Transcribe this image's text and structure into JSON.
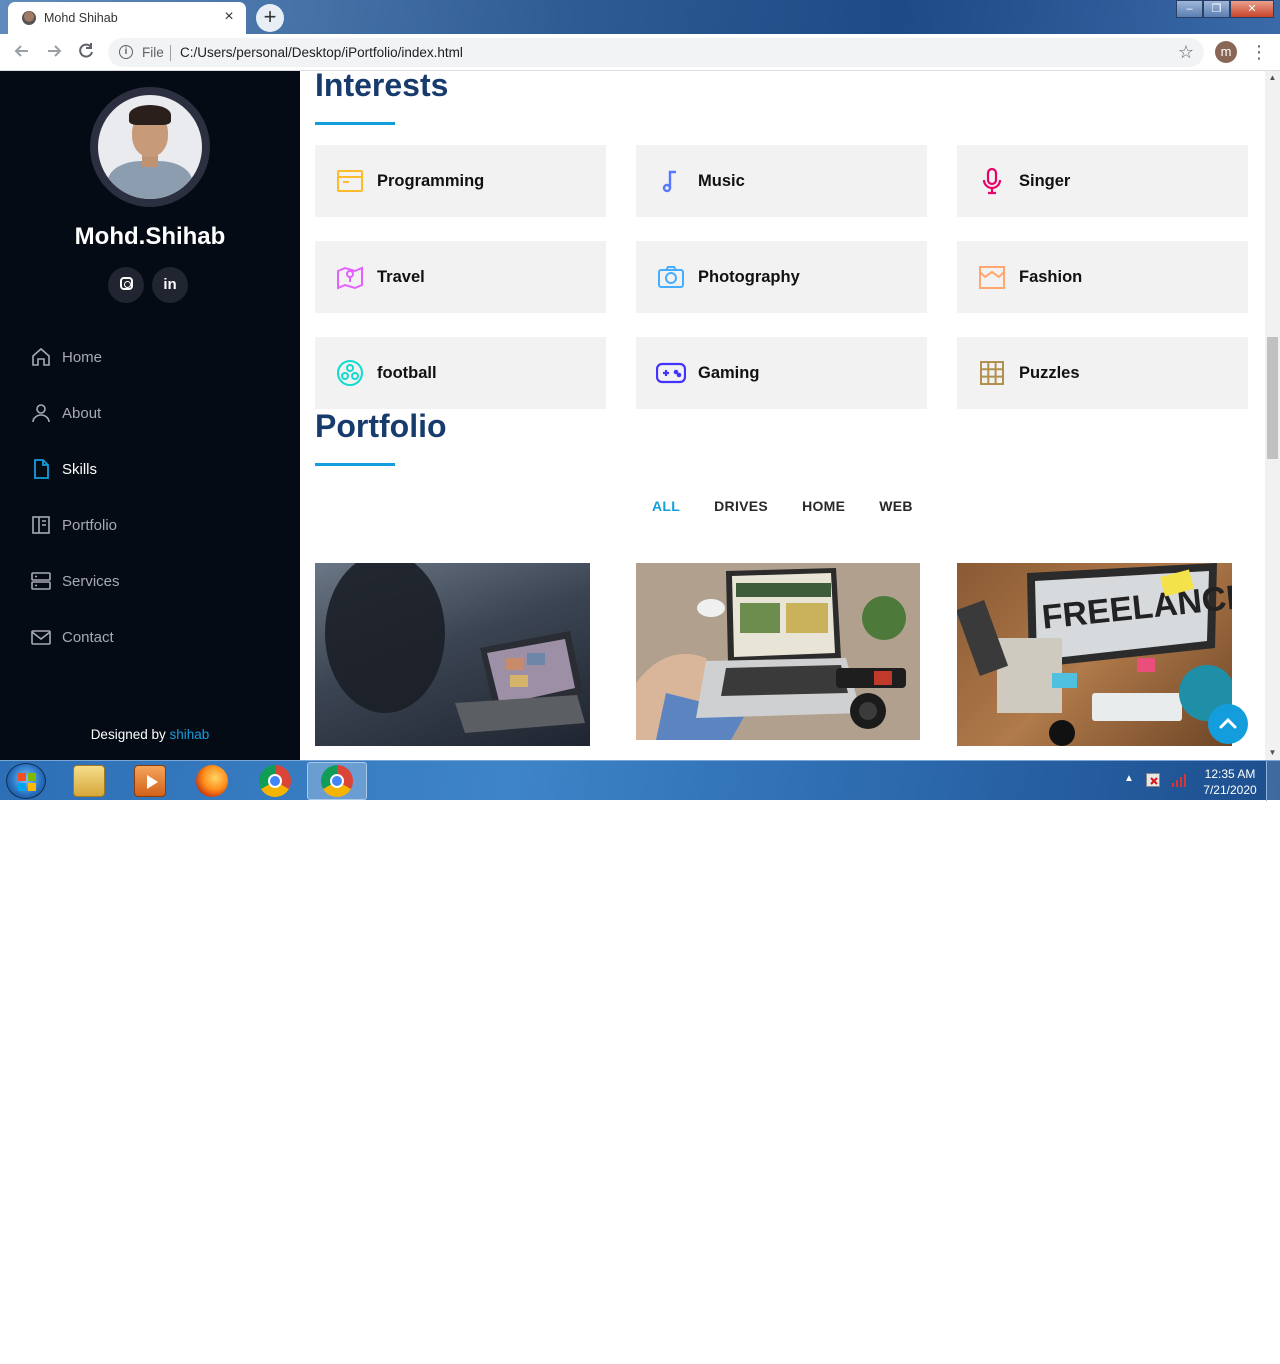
{
  "browser": {
    "tab_title": "Mohd Shihab",
    "tab_close": "×",
    "new_tab": "+",
    "scheme": "File",
    "url": "C:/Users/personal/Desktop/iPortfolio/index.html",
    "profile_initial": "m",
    "window_controls": [
      "–",
      "❐",
      "✕"
    ]
  },
  "sidebar": {
    "name": "Mohd.Shihab",
    "social": [
      {
        "icon": "instagram-icon"
      },
      {
        "icon": "linkedin-icon",
        "label": "in"
      }
    ],
    "nav": [
      {
        "label": "Home",
        "icon": "home-icon",
        "active": false
      },
      {
        "label": "About",
        "icon": "user-icon",
        "active": false
      },
      {
        "label": "Skills",
        "icon": "file-icon",
        "active": true
      },
      {
        "label": "Portfolio",
        "icon": "book-icon",
        "active": false
      },
      {
        "label": "Services",
        "icon": "server-icon",
        "active": false
      },
      {
        "label": "Contact",
        "icon": "envelope-icon",
        "active": false
      }
    ],
    "footer_prefix": "Designed by",
    "footer_credit": "shihab"
  },
  "interests": {
    "title": "Interests",
    "items": [
      {
        "label": "Programming",
        "icon": "browser-window-icon",
        "color": "#ffbb2c"
      },
      {
        "label": "Music",
        "icon": "music-note-icon",
        "color": "#5578ff"
      },
      {
        "label": "Singer",
        "icon": "microphone-icon",
        "color": "#e80368"
      },
      {
        "label": "Travel",
        "icon": "map-pin-icon",
        "color": "#e361ff"
      },
      {
        "label": "Photography",
        "icon": "camera-icon",
        "color": "#47aeff"
      },
      {
        "label": "Fashion",
        "icon": "store-icon",
        "color": "#ffa76e"
      },
      {
        "label": "football",
        "icon": "football-icon",
        "color": "#11dbcf"
      },
      {
        "label": "Gaming",
        "icon": "gamepad-icon",
        "color": "#4233ff"
      },
      {
        "label": "Puzzles",
        "icon": "grid-icon",
        "color": "#b2904f"
      }
    ]
  },
  "portfolio": {
    "title": "Portfolio",
    "filters": [
      "ALL",
      "DRIVES",
      "HOME",
      "WEB"
    ],
    "active_filter": "ALL",
    "freelance_text": "FREELANCE"
  },
  "taskbar": {
    "time": "12:35 AM",
    "date": "7/21/2020"
  },
  "colors": {
    "accent": "#149ddd",
    "heading": "#173b6c",
    "sidebar_bg": "#040b14"
  }
}
